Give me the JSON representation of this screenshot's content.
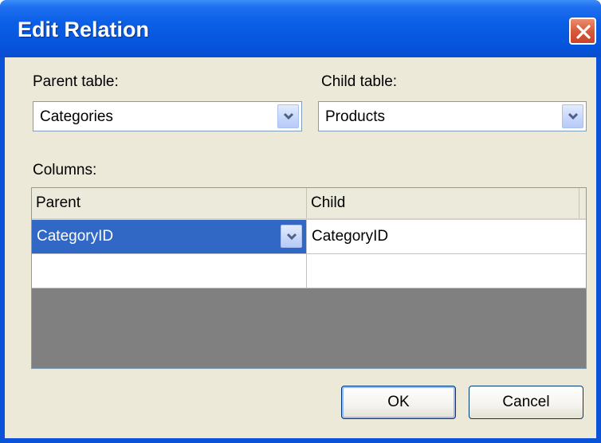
{
  "dialog": {
    "title": "Edit Relation",
    "close_icon": "close-icon"
  },
  "parent_table": {
    "label": "Parent table:",
    "selected": "Categories"
  },
  "child_table": {
    "label": "Child table:",
    "selected": "Products"
  },
  "columns": {
    "label": "Columns:",
    "headers": [
      "Parent",
      "Child"
    ],
    "rows": [
      {
        "parent": "CategoryID",
        "child": "CategoryID"
      },
      {
        "parent": "",
        "child": ""
      }
    ]
  },
  "buttons": {
    "ok": "OK",
    "cancel": "Cancel"
  },
  "colors": {
    "titlebar": "#0a5fe6",
    "selection": "#3168c5",
    "dialog_bg": "#ece9d8"
  }
}
